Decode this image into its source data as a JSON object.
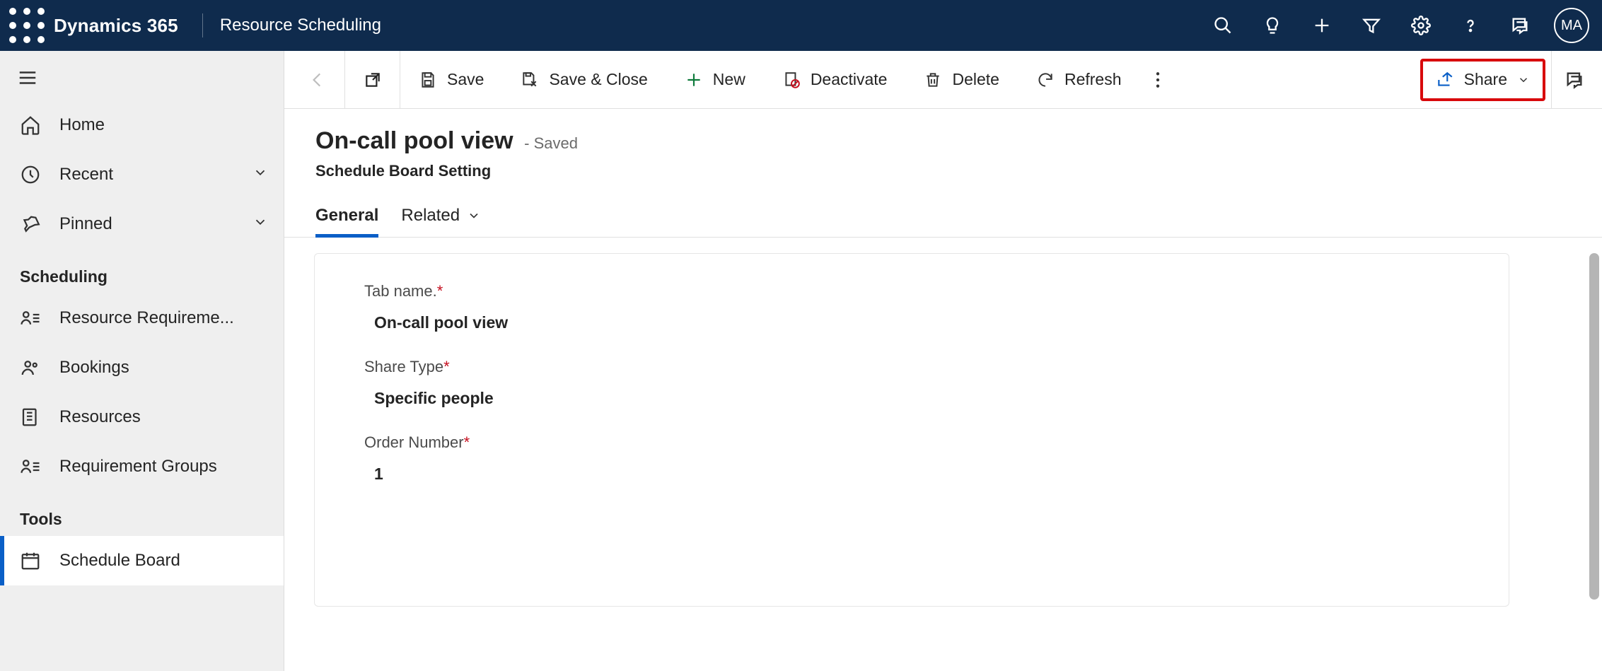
{
  "header": {
    "brand": "Dynamics 365",
    "area": "Resource Scheduling",
    "avatar_initials": "MA"
  },
  "nav": {
    "home": "Home",
    "recent": "Recent",
    "pinned": "Pinned",
    "group_scheduling": "Scheduling",
    "resource_requirements": "Resource Requireme...",
    "bookings": "Bookings",
    "resources": "Resources",
    "requirement_groups": "Requirement Groups",
    "group_tools": "Tools",
    "schedule_board": "Schedule Board"
  },
  "commands": {
    "save": "Save",
    "save_close": "Save & Close",
    "new": "New",
    "deactivate": "Deactivate",
    "delete": "Delete",
    "refresh": "Refresh",
    "share": "Share"
  },
  "record": {
    "title": "On-call pool view",
    "saved_tag": "- Saved",
    "entity": "Schedule Board Setting"
  },
  "tabs": {
    "general": "General",
    "related": "Related"
  },
  "fields": {
    "tab_name_label": "Tab name.",
    "tab_name_value": "On-call pool view",
    "share_type_label": "Share Type",
    "share_type_value": "Specific people",
    "order_number_label": "Order Number",
    "order_number_value": "1"
  }
}
